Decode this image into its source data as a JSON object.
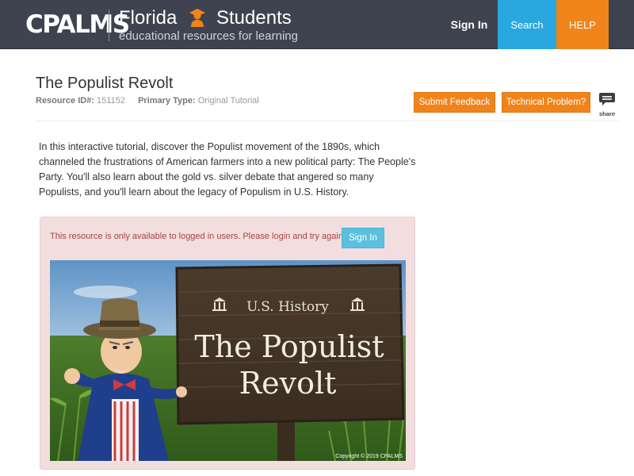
{
  "header": {
    "logo": "CPALMS",
    "brand_left": "Florida",
    "brand_right": "Students",
    "tagline": "educational resources for learning",
    "nav": {
      "sign_in": "Sign In",
      "search": "Search",
      "help": "HELP"
    }
  },
  "resource": {
    "title": "The Populist Revolt",
    "id_label": "Resource ID#:",
    "id_value": "151152",
    "type_label": "Primary Type:",
    "type_value": "Original Tutorial",
    "submit_feedback": "Submit Feedback",
    "technical_problem": "Technical Problem?",
    "share_label": "share",
    "description": "In this interactive tutorial, discover the Populist movement of the 1890s, which channeled the frustrations of American farmers into a new political party: The People's Party.  You'll also learn about the gold vs. silver debate that angered so many Populists, and you'll learn about the legacy of Populism in U.S. History."
  },
  "alert": {
    "message": "This resource is only available to logged in users. Please login and try again.",
    "sign_in": "Sign In"
  },
  "hero": {
    "subject": "U.S. History",
    "title_line1": "The Populist",
    "title_line2": "Revolt",
    "copyright": "Copyright © 2019 CPALMS"
  },
  "colors": {
    "header_bg": "#3f4350",
    "search_bg": "#29a8df",
    "help_bg": "#f0841b",
    "alert_bg": "#f2dede",
    "alert_text": "#a94442",
    "info_button": "#5bc0de"
  }
}
